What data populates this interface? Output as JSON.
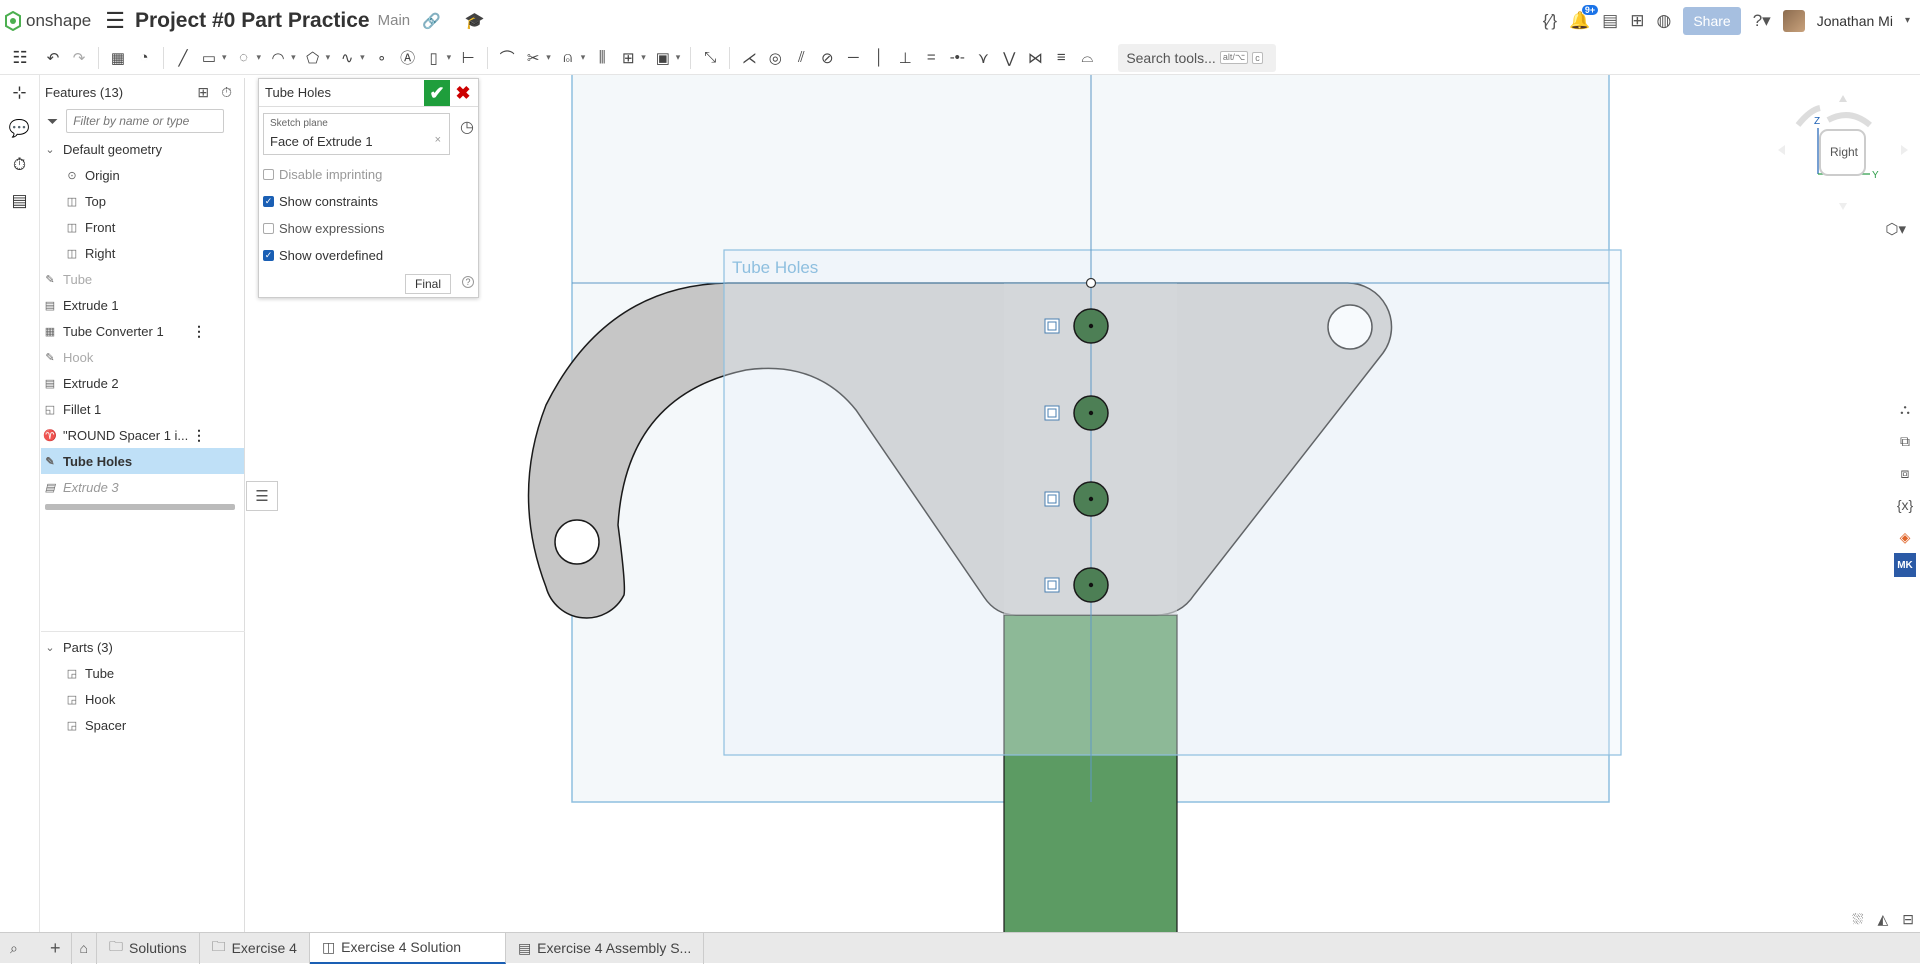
{
  "app": {
    "logo_text": "onshape",
    "doc_title": "Project #0 Part Practice",
    "branch": "Main",
    "notification_count": "9+",
    "share_label": "Share",
    "user_name": "Jonathan Mi"
  },
  "toolbar": {
    "search_placeholder": "Search tools...",
    "search_kbd_1": "alt/⌥",
    "search_kbd_2": "c"
  },
  "features": {
    "title": "Features (13)",
    "filter_placeholder": "Filter by name or type",
    "default_geometry": "Default geometry",
    "items_default": [
      {
        "label": "Origin"
      },
      {
        "label": "Top"
      },
      {
        "label": "Front"
      },
      {
        "label": "Right"
      }
    ],
    "items": [
      {
        "label": "Tube",
        "state": "dim"
      },
      {
        "label": "Extrude 1",
        "state": "normal"
      },
      {
        "label": "Tube Converter 1",
        "state": "normal"
      },
      {
        "label": "Hook",
        "state": "dim"
      },
      {
        "label": "Extrude 2",
        "state": "normal"
      },
      {
        "label": "Fillet 1",
        "state": "normal"
      },
      {
        "label": "\"ROUND Spacer 1 i...",
        "state": "normal"
      },
      {
        "label": "Tube Holes",
        "state": "selected"
      },
      {
        "label": "Extrude 3",
        "state": "italic"
      }
    ],
    "parts_title": "Parts (3)",
    "parts": [
      {
        "label": "Tube"
      },
      {
        "label": "Hook"
      },
      {
        "label": "Spacer"
      }
    ]
  },
  "sketch": {
    "title": "Tube Holes",
    "plane_label": "Sketch plane",
    "plane_value": "Face of Extrude 1",
    "options": [
      {
        "label": "Disable imprinting",
        "checked": false
      },
      {
        "label": "Show constraints",
        "checked": true
      },
      {
        "label": "Show expressions",
        "checked": false
      },
      {
        "label": "Show overdefined",
        "checked": true
      }
    ],
    "final_label": "Final"
  },
  "canvas": {
    "sketch_name": "Tube Holes",
    "view_name": "Right",
    "axis_z": "Z",
    "axis_y": "Y",
    "colors": {
      "part_gray": "#c6c6c6",
      "tube_green": "#5c9b63",
      "hole_green": "#4d7f55",
      "sketch_blue": "#7fb5d9",
      "plane_fill": "#eef5f9"
    }
  },
  "tabs": [
    {
      "label": "Solutions",
      "icon": "folder-icon"
    },
    {
      "label": "Exercise 4",
      "icon": "folder-icon"
    },
    {
      "label": "Exercise 4 Solution",
      "icon": "part-studio-icon",
      "active": true
    },
    {
      "label": "Exercise 4 Assembly S...",
      "icon": "assembly-icon"
    }
  ]
}
